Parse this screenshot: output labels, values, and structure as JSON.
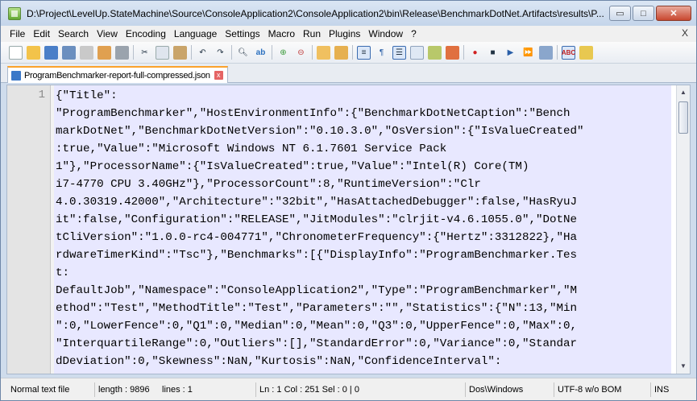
{
  "window": {
    "title": "D:\\Project\\LevelUp.StateMachine\\Source\\ConsoleApplication2\\ConsoleApplication2\\bin\\Release\\BenchmarkDotNet.Artifacts\\results\\P...",
    "buttons": {
      "minimize": "▭",
      "maximize": "□",
      "close": "✕"
    }
  },
  "menu": {
    "items": [
      "File",
      "Edit",
      "Search",
      "View",
      "Encoding",
      "Language",
      "Settings",
      "Macro",
      "Run",
      "Plugins",
      "Window",
      "?"
    ],
    "close_glyph": "X"
  },
  "toolbar": {
    "icons": [
      "new-file-icon",
      "open-file-icon",
      "save-icon",
      "save-all-icon",
      "close-icon",
      "close-all-icon",
      "print-icon",
      "cut-icon",
      "copy-icon",
      "paste-icon",
      "undo-icon",
      "redo-icon",
      "find-icon",
      "replace-icon",
      "zoom-in-icon",
      "zoom-out-icon",
      "sync-v-icon",
      "sync-h-icon",
      "word-wrap-icon",
      "show-all-chars-icon",
      "indent-guide-icon",
      "doc-map-icon",
      "function-list-icon",
      "folder-workspace-icon",
      "record-macro-icon",
      "stop-record-icon",
      "play-macro-icon",
      "run-macro-multiple-icon",
      "save-macro-icon",
      "spellcheck-icon",
      "plugin-icon"
    ]
  },
  "tab": {
    "label": "ProgramBenchmarker-report-full-compressed.json",
    "close_glyph": "x"
  },
  "editor": {
    "line_number": "1",
    "lines": [
      "{\"Title\":",
      "\"ProgramBenchmarker\",\"HostEnvironmentInfo\":{\"BenchmarkDotNetCaption\":\"Bench",
      "markDotNet\",\"BenchmarkDotNetVersion\":\"0.10.3.0\",\"OsVersion\":{\"IsValueCreated\"",
      ":true,\"Value\":\"Microsoft Windows NT 6.1.7601 Service Pack",
      "1\"},\"ProcessorName\":{\"IsValueCreated\":true,\"Value\":\"Intel(R) Core(TM)",
      "i7-4770 CPU 3.40GHz\"},\"ProcessorCount\":8,\"RuntimeVersion\":\"Clr",
      "4.0.30319.42000\",\"Architecture\":\"32bit\",\"HasAttachedDebugger\":false,\"HasRyuJ",
      "it\":false,\"Configuration\":\"RELEASE\",\"JitModules\":\"clrjit-v4.6.1055.0\",\"DotNe",
      "tCliVersion\":\"1.0.0-rc4-004771\",\"ChronometerFrequency\":{\"Hertz\":3312822},\"Ha",
      "rdwareTimerKind\":\"Tsc\"},\"Benchmarks\":[{\"DisplayInfo\":\"ProgramBenchmarker.Tes",
      "t:",
      "DefaultJob\",\"Namespace\":\"ConsoleApplication2\",\"Type\":\"ProgramBenchmarker\",\"M",
      "ethod\":\"Test\",\"MethodTitle\":\"Test\",\"Parameters\":\"\",\"Statistics\":{\"N\":13,\"Min",
      "\":0,\"LowerFence\":0,\"Q1\":0,\"Median\":0,\"Mean\":0,\"Q3\":0,\"UpperFence\":0,\"Max\":0,",
      "\"InterquartileRange\":0,\"Outliers\":[],\"StandardError\":0,\"Variance\":0,\"Standar",
      "dDeviation\":0,\"Skewness\":NaN,\"Kurtosis\":NaN,\"ConfidenceInterval\":"
    ]
  },
  "status": {
    "file_type": "Normal text file",
    "length": "length : 9896",
    "lines": "lines : 1",
    "position": "Ln : 1    Col : 251    Sel : 0 | 0",
    "eol": "Dos\\Windows",
    "encoding": "UTF-8 w/o BOM",
    "mode": "INS"
  },
  "colors": {
    "line_highlight": "#e8e8ff",
    "tab_accent": "#fba22c"
  }
}
